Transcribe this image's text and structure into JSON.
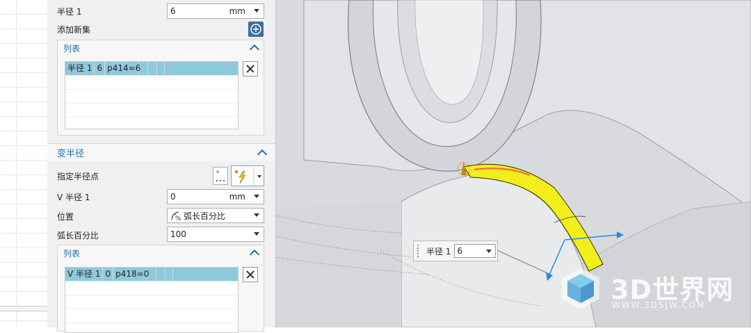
{
  "panel": {
    "radius1_label": "半径 1",
    "radius1_value": "6",
    "radius1_unit": "mm",
    "add_new_set_label": "添加新集",
    "list1": {
      "title": "列表",
      "rows": [
        {
          "c1": "半径 1",
          "c2": "6",
          "c3": "p414=6"
        }
      ]
    },
    "variable_radius": {
      "title": "变半径",
      "specify_point_label": "指定半径点",
      "v_radius_label": "V 半径 1",
      "v_radius_value": "0",
      "v_radius_unit": "mm",
      "position_label": "位置",
      "position_value": "弧长百分比",
      "arc_percent_label": "弧长百分比",
      "arc_percent_value": "100",
      "list2": {
        "title": "列表",
        "rows": [
          {
            "c1": "V 半径 1",
            "c2": "0",
            "c3": "p418=0"
          }
        ]
      }
    }
  },
  "viewport": {
    "callout_label": "半径 1",
    "callout_value": "6",
    "accent_yellow": "#f2ee1c",
    "handle_blue": "#1e8fe0"
  },
  "watermark": {
    "brand": "3D世界网",
    "url": "WWW.3DSJW.COM"
  }
}
